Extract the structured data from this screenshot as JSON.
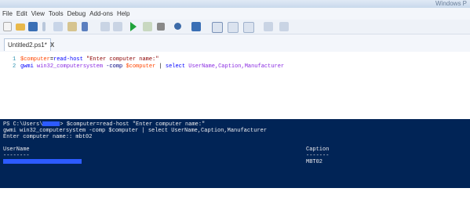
{
  "window": {
    "title": "Windows P"
  },
  "menu": [
    "File",
    "Edit",
    "View",
    "Tools",
    "Debug",
    "Add-ons",
    "Help"
  ],
  "toolbar": {
    "icons": [
      "new-icon",
      "open-icon",
      "save-icon",
      "cut-icon",
      "copy-icon",
      "paste-icon",
      "clear-icon",
      "undo-icon",
      "redo-icon",
      "run-icon",
      "run-selection-icon",
      "stop-icon",
      "debug-icon",
      "new-remote-icon",
      "show-script-pane-icon",
      "show-script-pane-right-icon",
      "show-script-pane-max-icon",
      "zoom-icon",
      "commands-icon"
    ],
    "colors": {
      "save": "#3a6fb5",
      "run": "#1fa33a",
      "stop": "#888888",
      "orange": "#e08a1e"
    }
  },
  "tab": {
    "label": "Untitled2.ps1*",
    "close": "X"
  },
  "editor": {
    "lines": [
      {
        "num": "1",
        "var": "$computer",
        "eq": "=",
        "cmd": "read-host",
        "str": "\"Enter computer name:\""
      },
      {
        "num": "2",
        "cmd": "gwmi",
        "arg": "win32_computersystem",
        "param": "-comp",
        "var": "$computer",
        "pipe": "|",
        "select": "select",
        "fields": "UserName,Caption,Manufacturer"
      }
    ]
  },
  "console": {
    "prompt_prefix": "PS C:\\Users\\",
    "prompt_suffix": "> $computer=read-host \"Enter computer name:\"",
    "line2": "gwmi win32_computersystem -comp $computer | select UserName,Caption,Manufacturer",
    "line3": "Enter computer name:: mbt02",
    "col_username": "UserName",
    "col_caption": "Caption",
    "dash_username": "--------",
    "dash_caption": "-------",
    "row_caption": "MBT02"
  }
}
